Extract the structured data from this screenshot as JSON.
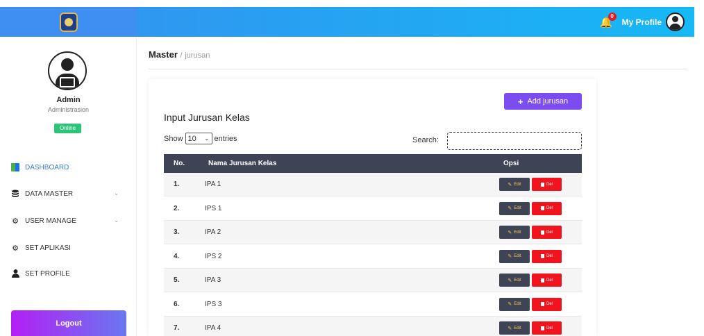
{
  "header": {
    "notification_count": "0",
    "profile_label": "My Profile",
    "brand_color": "#3f8ff3",
    "topbar_gradient": [
      "#2f97f0",
      "#16b8f5"
    ]
  },
  "sidebar": {
    "admin_name": "Admin",
    "admin_role": "Administrasion",
    "status": "Online",
    "items": [
      {
        "label": "DASHBOARD",
        "icon": "dashboard-icon"
      },
      {
        "label": "DATA MASTER",
        "icon": "database-icon"
      },
      {
        "label": "USER MANAGE",
        "icon": "gear-icon"
      },
      {
        "label": "SET APLIKASI",
        "icon": "cogs-icon"
      },
      {
        "label": "SET PROFILE",
        "icon": "user-icon"
      }
    ],
    "logout_label": "Logout"
  },
  "breadcrumb": {
    "main": "Master",
    "separator": "/",
    "sub": "jurusan"
  },
  "card": {
    "title": "Input Jurusan Kelas",
    "add_button": "Add jurusan",
    "show_label": "Show",
    "entries_value": "10",
    "entries_label": "entries",
    "search_label": "Search:",
    "search_value": ""
  },
  "table": {
    "headers": {
      "no": "No.",
      "name": "Nama Jurusan Kelas",
      "options": "Opsi"
    },
    "edit_label": "Edit",
    "del_label": "Del",
    "rows": [
      {
        "no": "1.",
        "name": "IPA 1"
      },
      {
        "no": "2.",
        "name": "IPS 1"
      },
      {
        "no": "3.",
        "name": "IPA 2"
      },
      {
        "no": "4.",
        "name": "IPS 2"
      },
      {
        "no": "5.",
        "name": "IPA 3"
      },
      {
        "no": "6.",
        "name": "IPS 3"
      },
      {
        "no": "7.",
        "name": "IPA 4"
      }
    ]
  }
}
